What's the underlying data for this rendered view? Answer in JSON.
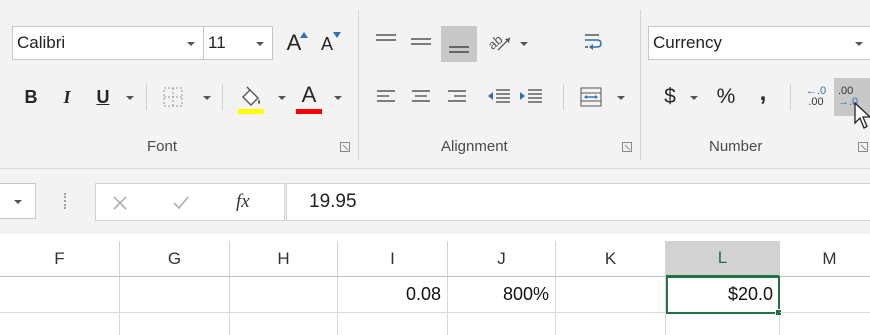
{
  "ribbon": {
    "font_group": {
      "label": "Font",
      "font_name": "Calibri",
      "font_size": "11",
      "increase_size_glyph": "A",
      "decrease_size_glyph": "A",
      "bold": "B",
      "italic": "I",
      "underline": "U",
      "font_color_glyph": "A",
      "fill_color": "#ffff00",
      "font_color": "#ff0000"
    },
    "alignment_group": {
      "label": "Alignment"
    },
    "number_group": {
      "label": "Number",
      "format": "Currency",
      "currency_symbol": "$",
      "percent_symbol": "%",
      "comma_symbol": ",",
      "increase_decimal_top": "←.0",
      "increase_decimal_bottom": ".00",
      "decrease_decimal_top": ".00",
      "decrease_decimal_bottom": "→.0"
    }
  },
  "formula_bar": {
    "fx_label": "fx",
    "content": "19.95"
  },
  "grid": {
    "columns": [
      "F",
      "G",
      "H",
      "I",
      "J",
      "K",
      "L",
      "M"
    ],
    "row": [
      "",
      "",
      "",
      "0.08",
      "800%",
      "",
      "$20.0",
      ""
    ],
    "active_column": "L",
    "accent_color": "#217346"
  }
}
